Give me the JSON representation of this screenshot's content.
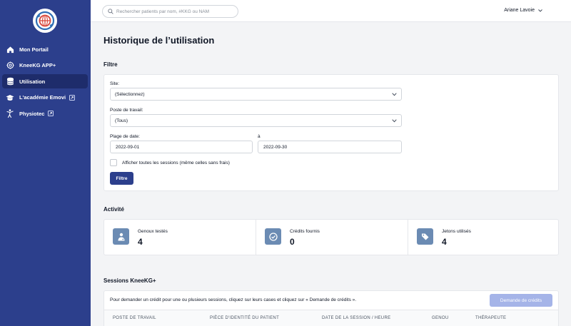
{
  "sidebar": {
    "logo_icon": "globe-logo-icon",
    "items": [
      {
        "label": "Mon Portail",
        "icon": "home-icon",
        "active": false,
        "external": false
      },
      {
        "label": "KneeKG APP+",
        "icon": "settings-icon",
        "active": false,
        "external": false
      },
      {
        "label": "Utilisation",
        "icon": "database-icon",
        "active": true,
        "external": false
      },
      {
        "label": "L'académie Emovi",
        "icon": "graduation-cap-icon",
        "active": false,
        "external": true
      },
      {
        "label": "Physiotec",
        "icon": "person-stretch-icon",
        "active": false,
        "external": true
      }
    ]
  },
  "topbar": {
    "search_placeholder": "Rechercher patients par nom, #KKG ou NAM",
    "user_name": "Ariane Lavoie"
  },
  "page": {
    "title": "Historique de l’utilisation"
  },
  "filter": {
    "section_title": "Filtre",
    "site_label": "Site:",
    "site_value": "(Sélectionnez)",
    "workstation_label": "Poste de travail:",
    "workstation_value": "(Tous)",
    "date_range_label": "Plage de date:",
    "date_from": "2022-09-01",
    "to_label": "à",
    "date_to": "2022-09-30",
    "show_all_label": "Afficher toutes les sessions (même celles sans frais)",
    "show_all_checked": false,
    "submit_label": "Filtre"
  },
  "activity": {
    "section_title": "Activité",
    "stats": [
      {
        "label": "Genoux testés",
        "value": "4",
        "icon": "doctor-icon"
      },
      {
        "label": "Crédits fournis",
        "value": "0",
        "icon": "check-circle-icon"
      },
      {
        "label": "Jetons utilisés",
        "value": "4",
        "icon": "tags-icon"
      }
    ]
  },
  "sessions": {
    "section_title": "Sessions KneeKG+",
    "info_text": "Pour demander un crédit pour une ou plusieurs sessions, cliquez sur leurs cases et cliquez sur « Demande de crédits ».",
    "request_button_label": "Demande de crédits",
    "columns": [
      "POSTE DE TRAVAIL",
      "PIÈCE D'IDENTITÉ DU PATIENT",
      "DATE DE LA SESSION / HEURE",
      "GENOU",
      "THÉRAPEUTE"
    ]
  },
  "colors": {
    "sidebar": "#2c3f8c",
    "sidebar_active": "#1e2c6b",
    "primary_button": "#2c3f8c",
    "disabled_button": "#a5b4e8",
    "stat_icon_bg": "#6b8bb3"
  }
}
